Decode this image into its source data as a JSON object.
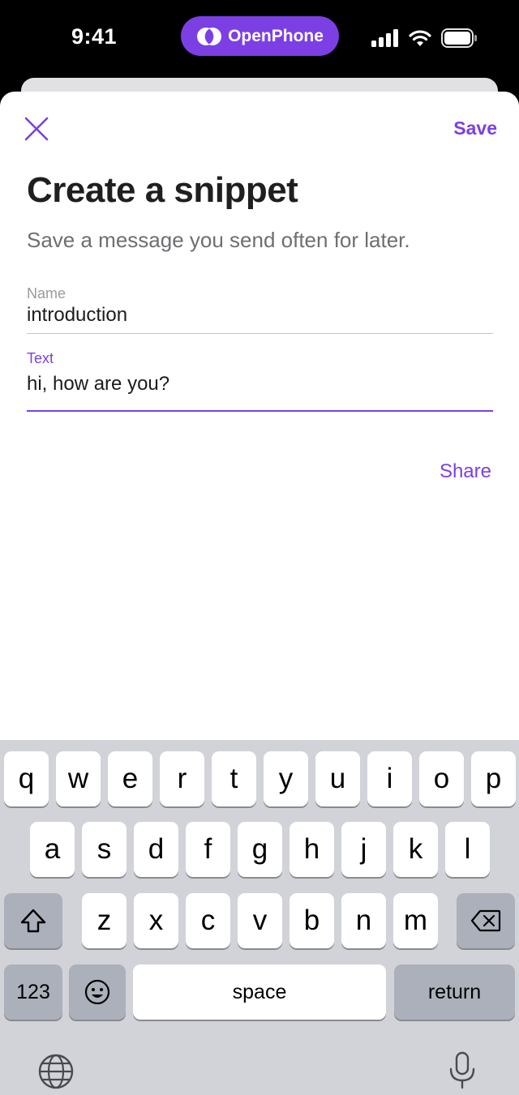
{
  "status_bar": {
    "time": "9:41",
    "dynamic_island_label": "OpenPhone",
    "icons": [
      "signal-icon",
      "wifi-icon",
      "battery-icon"
    ]
  },
  "header": {
    "close_icon": "close-icon",
    "save_label": "Save"
  },
  "content": {
    "title": "Create a snippet",
    "subtitle": "Save a message you send often for later.",
    "name_field": {
      "label": "Name",
      "value": "introduction"
    },
    "text_field": {
      "label": "Text",
      "value": "hi, how are you?"
    },
    "share_label": "Share"
  },
  "keyboard": {
    "row1": [
      "q",
      "w",
      "e",
      "r",
      "t",
      "y",
      "u",
      "i",
      "o",
      "p"
    ],
    "row2": [
      "a",
      "s",
      "d",
      "f",
      "g",
      "h",
      "j",
      "k",
      "l"
    ],
    "row3": [
      "z",
      "x",
      "c",
      "v",
      "b",
      "n",
      "m"
    ],
    "numbers_label": "123",
    "space_label": "space",
    "return_label": "return",
    "icons": [
      "shift-icon",
      "delete-icon",
      "emoji-icon",
      "globe-icon",
      "microphone-icon"
    ]
  },
  "colors": {
    "accent": "#7B3FE4",
    "keyboard_bg": "#D1D3D9",
    "key_bg": "#FFFFFF",
    "special_key_bg": "#ABB0BB"
  }
}
